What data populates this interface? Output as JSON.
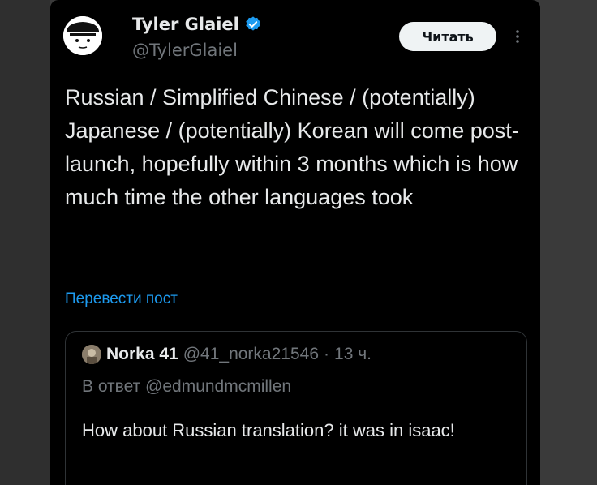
{
  "author": {
    "name": "Tyler Glaiel",
    "handle": "@TylerGlaiel",
    "avatar_icon": "cartoon-face-avatar",
    "verified_icon": "verified-badge-icon"
  },
  "actions": {
    "follow_label": "Читать",
    "more_icon": "more-vertical-icon"
  },
  "tweet": {
    "text": "Russian / Simplified Chinese / (potentially) Japanese / (potentially) Korean will come post-launch, hopefully within 3 months which is how much time the other languages took",
    "translate_label": "Перевести пост"
  },
  "quote": {
    "name": "Norka 41",
    "handle": "@41_norka21546",
    "separator": "·",
    "time": "13 ч.",
    "reply_to": "В ответ @edmundmcmillen",
    "text": "How about Russian translation? it was in isaac!"
  },
  "colors": {
    "background": "#000000",
    "text": "#e7e9ea",
    "muted": "#71767b",
    "accent": "#1d9bf0",
    "button_bg": "#eff3f4"
  }
}
